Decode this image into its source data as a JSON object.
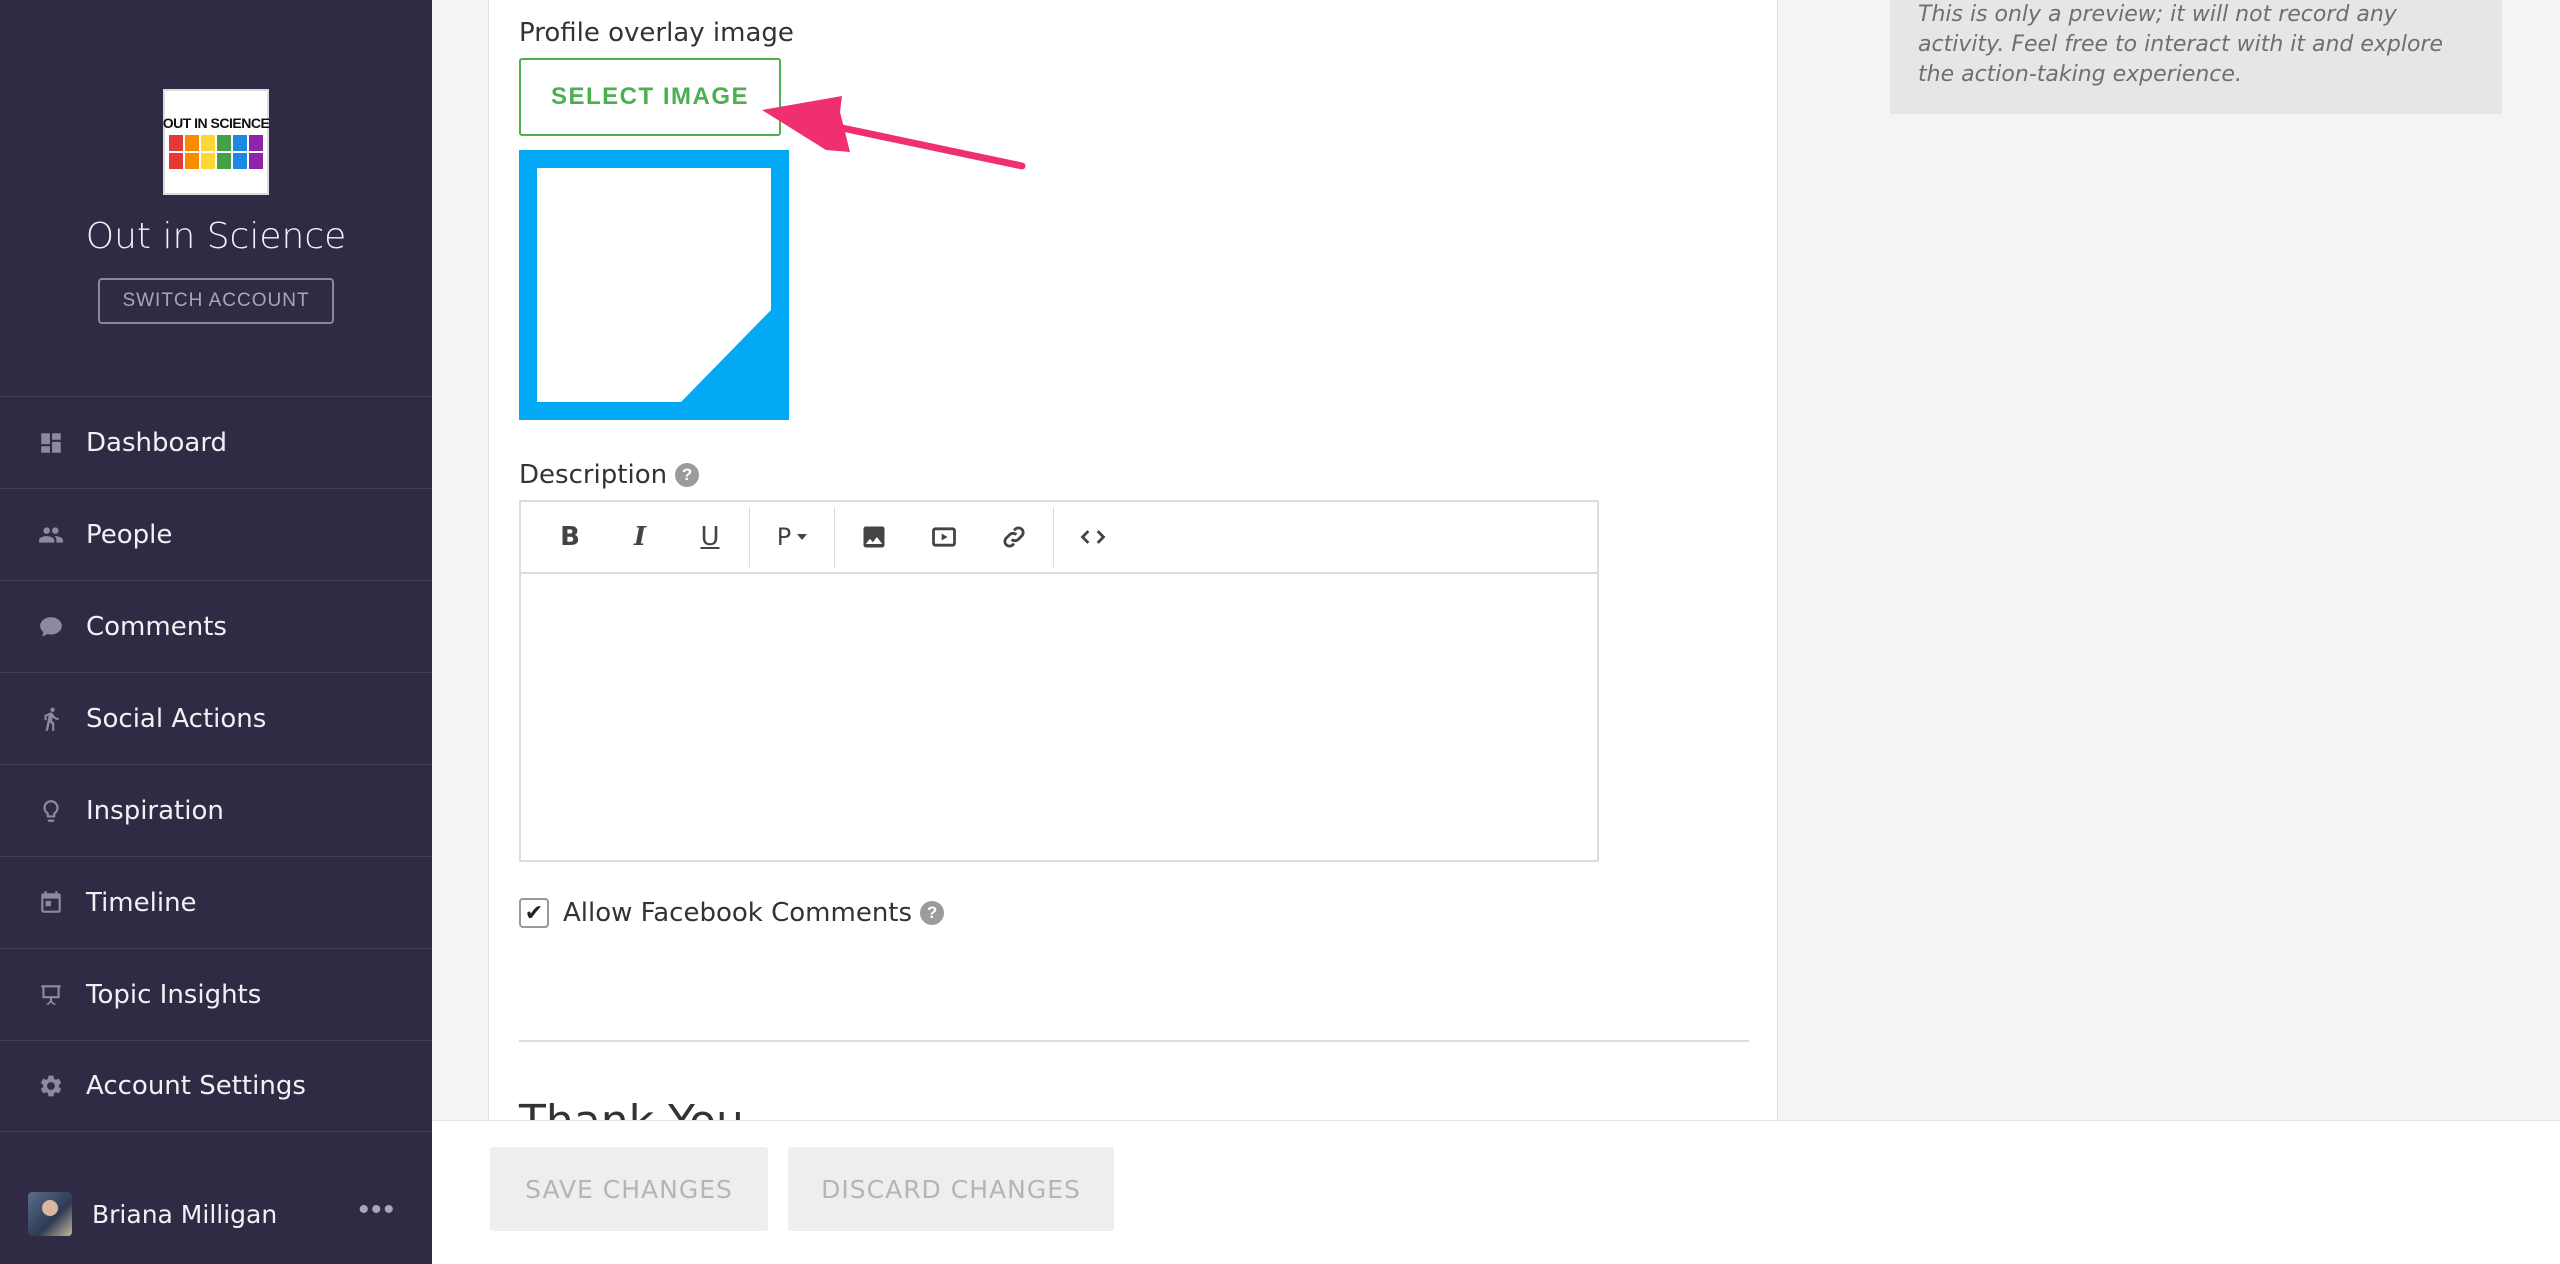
{
  "sidebar": {
    "account_name": "Out in Science",
    "logo_text": "OUT IN SCIENCE",
    "switch_account_label": "SWITCH ACCOUNT",
    "nav": [
      {
        "label": "Dashboard",
        "icon": "dashboard-icon"
      },
      {
        "label": "People",
        "icon": "people-icon"
      },
      {
        "label": "Comments",
        "icon": "comment-icon"
      },
      {
        "label": "Social Actions",
        "icon": "social-actions-icon"
      },
      {
        "label": "Inspiration",
        "icon": "lightbulb-icon"
      },
      {
        "label": "Timeline",
        "icon": "calendar-icon"
      },
      {
        "label": "Topic Insights",
        "icon": "presentation-icon"
      },
      {
        "label": "Account Settings",
        "icon": "gear-icon"
      }
    ],
    "user_name": "Briana Milligan",
    "more_label": "•••"
  },
  "form": {
    "overlay_label": "Profile overlay image",
    "select_image_label": "SELECT IMAGE",
    "description_label": "Description",
    "help_glyph": "?",
    "toolbar": {
      "bold": "B",
      "italic": "I",
      "underline": "U",
      "paragraph": "P"
    },
    "facebook_comments_label": "Allow Facebook Comments",
    "facebook_comments_checked": true,
    "next_section_title": "Thank You"
  },
  "preview_note": "This is only a preview; it will not record any activity. Feel free to interact with it and explore the action-taking experience.",
  "footer": {
    "save_label": "SAVE CHANGES",
    "discard_label": "DISCARD CHANGES"
  },
  "colors": {
    "sidebar_bg": "#302b45",
    "accent_green": "#4caf50",
    "overlay_blue": "#03a9f4",
    "annotation_pink": "#f0306e"
  }
}
